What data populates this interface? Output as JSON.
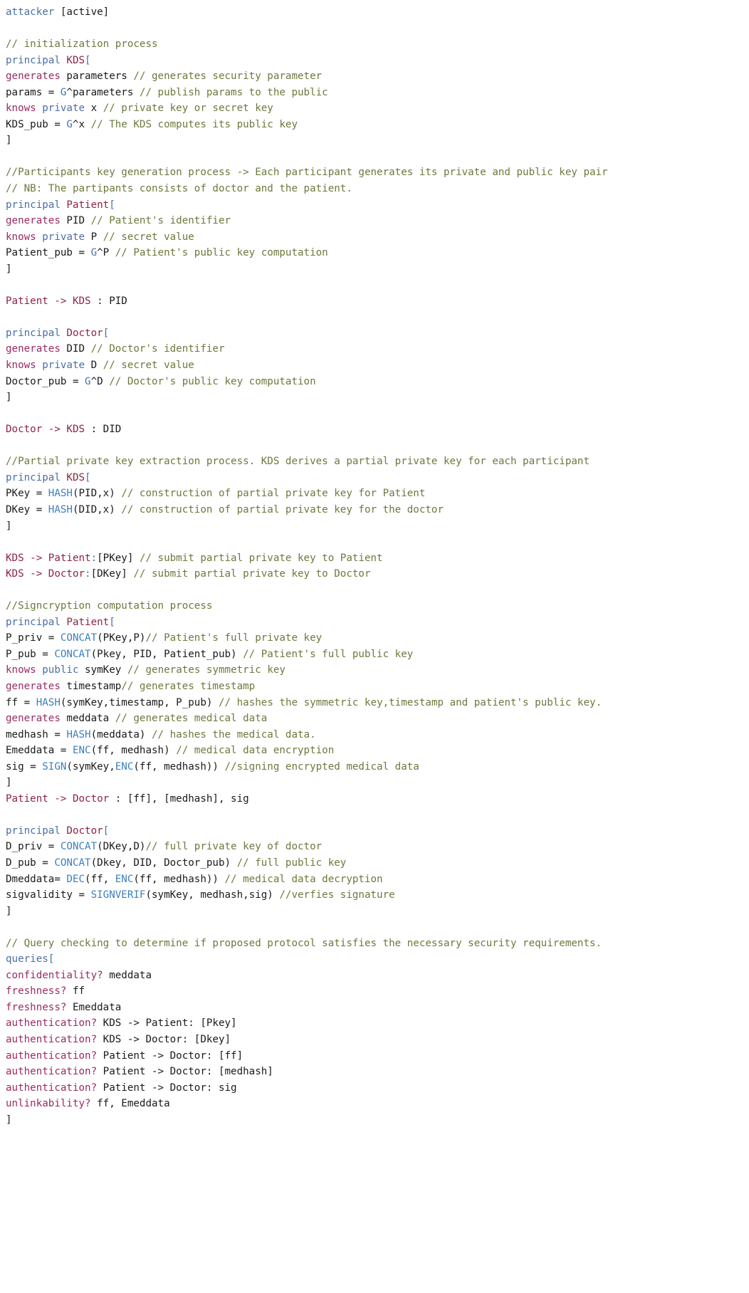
{
  "document": {
    "title": "Verifpal protocol model source listing",
    "language": "verifpal",
    "colors": {
      "background": "#ffffff",
      "plain": "#1a1a1a",
      "comment": "#6b7a3c",
      "keyword": "#4a6fa5",
      "declaration": "#9b2a62",
      "principal": "#8e2342",
      "function": "#3d7fbd",
      "bracket": "#4a6fa5",
      "query": "#9b2a62"
    }
  },
  "lines": [
    {
      "tokens": [
        {
          "t": "attacker",
          "c": "keyword"
        },
        {
          "t": " [active]",
          "c": "plain"
        }
      ]
    },
    {
      "tokens": []
    },
    {
      "tokens": [
        {
          "t": "// initialization process",
          "c": "comment"
        }
      ]
    },
    {
      "tokens": [
        {
          "t": "principal",
          "c": "keyword"
        },
        {
          "t": " ",
          "c": "plain"
        },
        {
          "t": "KDS",
          "c": "principal"
        },
        {
          "t": "[",
          "c": "bracket"
        }
      ]
    },
    {
      "tokens": [
        {
          "t": "generates",
          "c": "declaration"
        },
        {
          "t": " parameters ",
          "c": "plain"
        },
        {
          "t": "// generates security parameter",
          "c": "comment"
        }
      ]
    },
    {
      "tokens": [
        {
          "t": "params = ",
          "c": "plain"
        },
        {
          "t": "G",
          "c": "keyword"
        },
        {
          "t": "^parameters ",
          "c": "plain"
        },
        {
          "t": "// publish params to the public",
          "c": "comment"
        }
      ]
    },
    {
      "tokens": [
        {
          "t": "knows",
          "c": "declaration"
        },
        {
          "t": " ",
          "c": "plain"
        },
        {
          "t": "private",
          "c": "keyword"
        },
        {
          "t": " x ",
          "c": "plain"
        },
        {
          "t": "// private key or secret key",
          "c": "comment"
        }
      ]
    },
    {
      "tokens": [
        {
          "t": "KDS_pub = ",
          "c": "plain"
        },
        {
          "t": "G",
          "c": "keyword"
        },
        {
          "t": "^x ",
          "c": "plain"
        },
        {
          "t": "// The KDS computes its public key",
          "c": "comment"
        }
      ]
    },
    {
      "tokens": [
        {
          "t": "]",
          "c": "plain"
        }
      ]
    },
    {
      "tokens": []
    },
    {
      "tokens": [
        {
          "t": "//Participants key generation process -> Each participant generates its private and public key pair",
          "c": "comment"
        }
      ]
    },
    {
      "tokens": [
        {
          "t": "// NB: The partipants consists of doctor and the patient.",
          "c": "comment"
        }
      ]
    },
    {
      "tokens": [
        {
          "t": "principal",
          "c": "keyword"
        },
        {
          "t": " ",
          "c": "plain"
        },
        {
          "t": "Patient",
          "c": "principal"
        },
        {
          "t": "[",
          "c": "bracket"
        }
      ]
    },
    {
      "tokens": [
        {
          "t": "generates",
          "c": "declaration"
        },
        {
          "t": " PID ",
          "c": "plain"
        },
        {
          "t": "// Patient's identifier",
          "c": "comment"
        }
      ]
    },
    {
      "tokens": [
        {
          "t": "knows",
          "c": "declaration"
        },
        {
          "t": " ",
          "c": "plain"
        },
        {
          "t": "private",
          "c": "keyword"
        },
        {
          "t": " P ",
          "c": "plain"
        },
        {
          "t": "// secret value",
          "c": "comment"
        }
      ]
    },
    {
      "tokens": [
        {
          "t": "Patient_pub = ",
          "c": "plain"
        },
        {
          "t": "G",
          "c": "keyword"
        },
        {
          "t": "^P ",
          "c": "plain"
        },
        {
          "t": "// Patient's public key computation",
          "c": "comment"
        }
      ]
    },
    {
      "tokens": [
        {
          "t": "]",
          "c": "plain"
        }
      ]
    },
    {
      "tokens": []
    },
    {
      "tokens": [
        {
          "t": "Patient",
          "c": "principal"
        },
        {
          "t": " -> ",
          "c": "arrow"
        },
        {
          "t": "KDS",
          "c": "principal"
        },
        {
          "t": " : ",
          "c": "plain"
        },
        {
          "t": "PID",
          "c": "plain"
        }
      ]
    },
    {
      "tokens": []
    },
    {
      "tokens": [
        {
          "t": "principal",
          "c": "keyword"
        },
        {
          "t": " ",
          "c": "plain"
        },
        {
          "t": "Doctor",
          "c": "principal"
        },
        {
          "t": "[",
          "c": "bracket"
        }
      ]
    },
    {
      "tokens": [
        {
          "t": "generates",
          "c": "declaration"
        },
        {
          "t": " DID ",
          "c": "plain"
        },
        {
          "t": "// Doctor's identifier",
          "c": "comment"
        }
      ]
    },
    {
      "tokens": [
        {
          "t": "knows",
          "c": "declaration"
        },
        {
          "t": " ",
          "c": "plain"
        },
        {
          "t": "private",
          "c": "keyword"
        },
        {
          "t": " D ",
          "c": "plain"
        },
        {
          "t": "// secret value",
          "c": "comment"
        }
      ]
    },
    {
      "tokens": [
        {
          "t": "Doctor_pub = ",
          "c": "plain"
        },
        {
          "t": "G",
          "c": "keyword"
        },
        {
          "t": "^D ",
          "c": "plain"
        },
        {
          "t": "// Doctor's public key computation",
          "c": "comment"
        }
      ]
    },
    {
      "tokens": [
        {
          "t": "]",
          "c": "plain"
        }
      ]
    },
    {
      "tokens": []
    },
    {
      "tokens": [
        {
          "t": "Doctor",
          "c": "principal"
        },
        {
          "t": " -> ",
          "c": "arrow"
        },
        {
          "t": "KDS",
          "c": "principal"
        },
        {
          "t": " : ",
          "c": "plain"
        },
        {
          "t": "DID",
          "c": "plain"
        }
      ]
    },
    {
      "tokens": []
    },
    {
      "tokens": [
        {
          "t": "//Partial private key extraction process. KDS derives a partial private key for each participant",
          "c": "comment"
        }
      ]
    },
    {
      "tokens": [
        {
          "t": "principal",
          "c": "keyword"
        },
        {
          "t": " ",
          "c": "plain"
        },
        {
          "t": "KDS",
          "c": "principal"
        },
        {
          "t": "[",
          "c": "bracket"
        }
      ]
    },
    {
      "tokens": [
        {
          "t": "PKey = ",
          "c": "plain"
        },
        {
          "t": "HASH",
          "c": "func"
        },
        {
          "t": "(PID,x) ",
          "c": "plain"
        },
        {
          "t": "// construction of partial private key for Patient",
          "c": "comment"
        }
      ]
    },
    {
      "tokens": [
        {
          "t": "DKey = ",
          "c": "plain"
        },
        {
          "t": "HASH",
          "c": "func"
        },
        {
          "t": "(DID,x) ",
          "c": "plain"
        },
        {
          "t": "// construction of partial private key for the doctor",
          "c": "comment"
        }
      ]
    },
    {
      "tokens": [
        {
          "t": "]",
          "c": "plain"
        }
      ]
    },
    {
      "tokens": []
    },
    {
      "tokens": [
        {
          "t": "KDS",
          "c": "principal"
        },
        {
          "t": " -> ",
          "c": "arrow"
        },
        {
          "t": "Patient",
          "c": "principal"
        },
        {
          "t": ":",
          "c": "bracket"
        },
        {
          "t": "[PKey] ",
          "c": "plain"
        },
        {
          "t": "// submit partial private key to Patient",
          "c": "comment"
        }
      ]
    },
    {
      "tokens": [
        {
          "t": "KDS",
          "c": "principal"
        },
        {
          "t": " -> ",
          "c": "arrow"
        },
        {
          "t": "Doctor",
          "c": "principal"
        },
        {
          "t": ":",
          "c": "bracket"
        },
        {
          "t": "[DKey] ",
          "c": "plain"
        },
        {
          "t": "// submit partial private key to Doctor",
          "c": "comment"
        }
      ]
    },
    {
      "tokens": []
    },
    {
      "tokens": [
        {
          "t": "//Signcryption computation process",
          "c": "comment"
        }
      ]
    },
    {
      "tokens": [
        {
          "t": "principal",
          "c": "keyword"
        },
        {
          "t": " ",
          "c": "plain"
        },
        {
          "t": "Patient",
          "c": "principal"
        },
        {
          "t": "[",
          "c": "bracket"
        }
      ]
    },
    {
      "tokens": [
        {
          "t": "P_priv = ",
          "c": "plain"
        },
        {
          "t": "CONCAT",
          "c": "func"
        },
        {
          "t": "(PKey,P)",
          "c": "plain"
        },
        {
          "t": "// Patient's full private key",
          "c": "comment"
        }
      ]
    },
    {
      "tokens": [
        {
          "t": "P_pub = ",
          "c": "plain"
        },
        {
          "t": "CONCAT",
          "c": "func"
        },
        {
          "t": "(Pkey, PID, Patient_pub) ",
          "c": "plain"
        },
        {
          "t": "// Patient's full public key",
          "c": "comment"
        }
      ]
    },
    {
      "tokens": [
        {
          "t": "knows",
          "c": "declaration"
        },
        {
          "t": " ",
          "c": "plain"
        },
        {
          "t": "public",
          "c": "keyword"
        },
        {
          "t": " symKey ",
          "c": "plain"
        },
        {
          "t": "// generates symmetric key",
          "c": "comment"
        }
      ]
    },
    {
      "tokens": [
        {
          "t": "generates",
          "c": "declaration"
        },
        {
          "t": " timestamp",
          "c": "plain"
        },
        {
          "t": "// generates timestamp",
          "c": "comment"
        }
      ]
    },
    {
      "tokens": [
        {
          "t": "ff = ",
          "c": "plain"
        },
        {
          "t": "HASH",
          "c": "func"
        },
        {
          "t": "(symKey,timestamp, P_pub) ",
          "c": "plain"
        },
        {
          "t": "// hashes the symmetric key,timestamp and patient's public key.",
          "c": "comment"
        }
      ]
    },
    {
      "tokens": [
        {
          "t": "generates",
          "c": "declaration"
        },
        {
          "t": " meddata ",
          "c": "plain"
        },
        {
          "t": "// generates medical data",
          "c": "comment"
        }
      ]
    },
    {
      "tokens": [
        {
          "t": "medhash = ",
          "c": "plain"
        },
        {
          "t": "HASH",
          "c": "func"
        },
        {
          "t": "(meddata) ",
          "c": "plain"
        },
        {
          "t": "// hashes the medical data.",
          "c": "comment"
        }
      ]
    },
    {
      "tokens": [
        {
          "t": "Emeddata = ",
          "c": "plain"
        },
        {
          "t": "ENC",
          "c": "func"
        },
        {
          "t": "(ff, medhash) ",
          "c": "plain"
        },
        {
          "t": "// medical data encryption",
          "c": "comment"
        }
      ]
    },
    {
      "tokens": [
        {
          "t": "sig = ",
          "c": "plain"
        },
        {
          "t": "SIGN",
          "c": "func"
        },
        {
          "t": "(symKey,",
          "c": "plain"
        },
        {
          "t": "ENC",
          "c": "func"
        },
        {
          "t": "(ff, medhash)) ",
          "c": "plain"
        },
        {
          "t": "//signing encrypted medical data",
          "c": "comment"
        }
      ]
    },
    {
      "tokens": [
        {
          "t": "]",
          "c": "plain"
        }
      ]
    },
    {
      "tokens": [
        {
          "t": "Patient",
          "c": "principal"
        },
        {
          "t": " -> ",
          "c": "arrow"
        },
        {
          "t": "Doctor",
          "c": "principal"
        },
        {
          "t": " : [ff], [medhash], sig",
          "c": "plain"
        }
      ]
    },
    {
      "tokens": []
    },
    {
      "tokens": [
        {
          "t": "principal",
          "c": "keyword"
        },
        {
          "t": " ",
          "c": "plain"
        },
        {
          "t": "Doctor",
          "c": "principal"
        },
        {
          "t": "[",
          "c": "bracket"
        }
      ]
    },
    {
      "tokens": [
        {
          "t": "D_priv = ",
          "c": "plain"
        },
        {
          "t": "CONCAT",
          "c": "func"
        },
        {
          "t": "(DKey,D)",
          "c": "plain"
        },
        {
          "t": "// full private key of doctor",
          "c": "comment"
        }
      ]
    },
    {
      "tokens": [
        {
          "t": "D_pub = ",
          "c": "plain"
        },
        {
          "t": "CONCAT",
          "c": "func"
        },
        {
          "t": "(Dkey, DID, Doctor_pub) ",
          "c": "plain"
        },
        {
          "t": "// full public key",
          "c": "comment"
        }
      ]
    },
    {
      "tokens": [
        {
          "t": "Dmeddata= ",
          "c": "plain"
        },
        {
          "t": "DEC",
          "c": "func"
        },
        {
          "t": "(ff, ",
          "c": "plain"
        },
        {
          "t": "ENC",
          "c": "func"
        },
        {
          "t": "(ff, medhash)) ",
          "c": "plain"
        },
        {
          "t": "// medical data decryption",
          "c": "comment"
        }
      ]
    },
    {
      "tokens": [
        {
          "t": "sigvalidity = ",
          "c": "plain"
        },
        {
          "t": "SIGNVERIF",
          "c": "func"
        },
        {
          "t": "(symKey, medhash,sig) ",
          "c": "plain"
        },
        {
          "t": "//verfies signature",
          "c": "comment"
        }
      ]
    },
    {
      "tokens": [
        {
          "t": "]",
          "c": "plain"
        }
      ]
    },
    {
      "tokens": []
    },
    {
      "tokens": [
        {
          "t": "// Query checking to determine if proposed protocol satisfies the necessary security requirements.",
          "c": "comment"
        }
      ]
    },
    {
      "tokens": [
        {
          "t": "queries",
          "c": "keyword"
        },
        {
          "t": "[",
          "c": "bracket"
        }
      ]
    },
    {
      "tokens": [
        {
          "t": "confidentiality?",
          "c": "query"
        },
        {
          "t": " meddata",
          "c": "plain"
        }
      ]
    },
    {
      "tokens": [
        {
          "t": "freshness?",
          "c": "query"
        },
        {
          "t": " ff",
          "c": "plain"
        }
      ]
    },
    {
      "tokens": [
        {
          "t": "freshness?",
          "c": "query"
        },
        {
          "t": " Emeddata",
          "c": "plain"
        }
      ]
    },
    {
      "tokens": [
        {
          "t": "authentication?",
          "c": "query"
        },
        {
          "t": " KDS -> Patient: [Pkey]",
          "c": "plain"
        }
      ]
    },
    {
      "tokens": [
        {
          "t": "authentication?",
          "c": "query"
        },
        {
          "t": " KDS -> Doctor: [Dkey]",
          "c": "plain"
        }
      ]
    },
    {
      "tokens": [
        {
          "t": "authentication?",
          "c": "query"
        },
        {
          "t": " Patient -> Doctor: [ff]",
          "c": "plain"
        }
      ]
    },
    {
      "tokens": [
        {
          "t": "authentication?",
          "c": "query"
        },
        {
          "t": " Patient -> Doctor: [medhash]",
          "c": "plain"
        }
      ]
    },
    {
      "tokens": [
        {
          "t": "authentication?",
          "c": "query"
        },
        {
          "t": " Patient -> Doctor: sig",
          "c": "plain"
        }
      ]
    },
    {
      "tokens": [
        {
          "t": "unlinkability?",
          "c": "query"
        },
        {
          "t": " ff, Emeddata",
          "c": "plain"
        }
      ]
    },
    {
      "tokens": [
        {
          "t": "]",
          "c": "plain"
        }
      ]
    }
  ]
}
